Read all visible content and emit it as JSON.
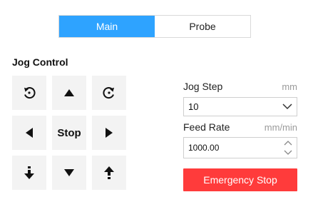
{
  "tabs": [
    {
      "label": "Main",
      "active": true
    },
    {
      "label": "Probe",
      "active": false
    }
  ],
  "jog_control": {
    "title": "Jog Control",
    "stop_label": "Stop",
    "buttons": [
      {
        "icon": "rotate-ccw-icon"
      },
      {
        "icon": "arrow-up-icon"
      },
      {
        "icon": "rotate-cw-icon"
      },
      {
        "icon": "arrow-left-icon"
      },
      {
        "icon": "stop"
      },
      {
        "icon": "arrow-right-icon"
      },
      {
        "icon": "z-down-icon"
      },
      {
        "icon": "arrow-down-icon"
      },
      {
        "icon": "z-up-icon"
      }
    ]
  },
  "jog_step": {
    "label": "Jog Step",
    "unit": "mm",
    "value": "10"
  },
  "feed_rate": {
    "label": "Feed Rate",
    "unit": "mm/min",
    "value": "1000.00"
  },
  "emergency_stop": {
    "label": "Emergency Stop"
  },
  "colors": {
    "tab_active": "#2ea3ff",
    "button_bg": "#f3f3f3",
    "estop": "#ff3b3b",
    "unit_text": "#9a9a9a",
    "border": "#cfcfcf"
  }
}
